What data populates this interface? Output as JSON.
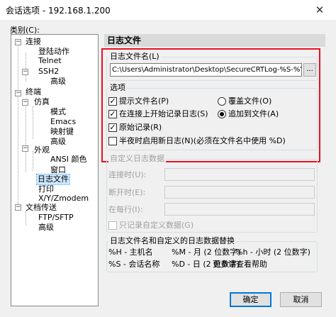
{
  "window": {
    "title": "会话选项 - 192.168.1.200"
  },
  "category_label": "类别(C):",
  "tree": {
    "items": [
      {
        "label": "连接"
      },
      {
        "label": "登陆动作"
      },
      {
        "label": "Telnet"
      },
      {
        "label": "SSH2"
      },
      {
        "label": "高级"
      },
      {
        "label": "终端"
      },
      {
        "label": "仿真"
      },
      {
        "label": "模式"
      },
      {
        "label": "Emacs"
      },
      {
        "label": "映射键"
      },
      {
        "label": "高级"
      },
      {
        "label": "外观"
      },
      {
        "label": "ANSI 颜色"
      },
      {
        "label": "窗口"
      },
      {
        "label": "日志文件"
      },
      {
        "label": "打印"
      },
      {
        "label": "X/Y/Zmodem"
      },
      {
        "label": "文档传送"
      },
      {
        "label": "FTP/SFTP"
      },
      {
        "label": "高级"
      }
    ],
    "selected": "日志文件"
  },
  "panel": {
    "header": "日志文件",
    "filename_label": "日志文件名(L)",
    "filename_value": "C:\\Users\\Administrator\\Desktop\\SecureCRTLog-%S-%Y%M%D",
    "browse_label": "...",
    "options_label": "选项",
    "opt_prompt_filename": "提示文件名(P)",
    "opt_start_on_connect": "在连接上开始记录日志(S)",
    "opt_raw_log": "原始记录(R)",
    "opt_midnight": "半夜时启用新日志(N)(必须在文件名中使用 %D)",
    "opt_overwrite": "覆盖文件(O)",
    "opt_append": "追加到文件(A)",
    "custom_label": "自定义日志数据",
    "on_connect": "连接时(U):",
    "on_disconnect": "断开时(E):",
    "on_each_line": "在每行(I):",
    "only_custom": "只记录自定义数据(G)",
    "subst_label": "日志文件名和自定义的日志数据替换",
    "subst": [
      [
        "%H - 主机名",
        "%M - 月 (2 位数字)",
        "%h - 小时 (2 位数字)"
      ],
      [
        "%S - 会话名称",
        "%D - 日 (2 位数字)",
        "更多请查看帮助"
      ]
    ]
  },
  "buttons": {
    "ok": "确定",
    "cancel": "取消"
  }
}
